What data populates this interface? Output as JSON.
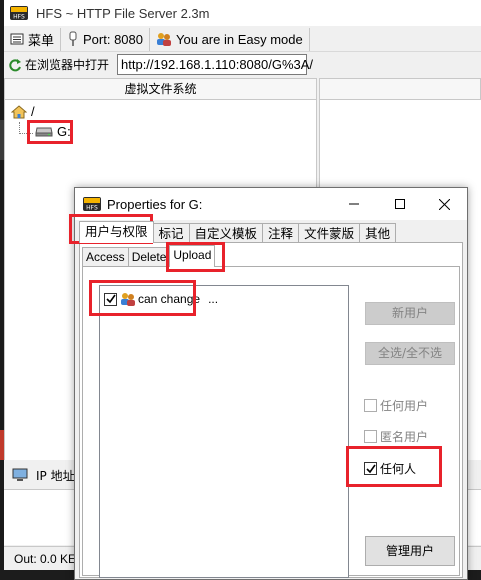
{
  "main_window": {
    "title": "HFS ~ HTTP File Server 2.3m",
    "toolbar": {
      "menu_label": "菜单",
      "port_label": "Port: 8080",
      "mode_label": "You are in Easy mode"
    },
    "open_browser_label": "在浏览器中打开",
    "url": "http://192.168.1.110:8080/G%3A/",
    "vfs_header": "虚拟文件系统",
    "tree": {
      "root_label": "/",
      "drive_label": "G:"
    },
    "log_header_label": "IP 地址",
    "status_text": "Out: 0.0 KE"
  },
  "dialog": {
    "title": "Properties for G:",
    "outer_tabs": [
      "用户与权限",
      "标记",
      "自定义模板",
      "注释",
      "文件蒙版",
      "其他"
    ],
    "inner_tabs": [
      "Access",
      "Delete",
      "Upload"
    ],
    "user_list": {
      "item_label": "can change",
      "item_checked": true,
      "more": "..."
    },
    "buttons": {
      "new_user": "新用户",
      "select_all": "全选/全不选",
      "manage_users": "管理用户"
    },
    "checkboxes": {
      "any_account": {
        "label": "任何用户",
        "checked": false
      },
      "anonymous": {
        "label": "匿名用户",
        "checked": false
      },
      "anyone": {
        "label": "任何人",
        "checked": true
      }
    }
  },
  "colors": {
    "highlight": "#e8222b",
    "window_bg": "#f0f0f0",
    "disabled_text": "#838383"
  }
}
